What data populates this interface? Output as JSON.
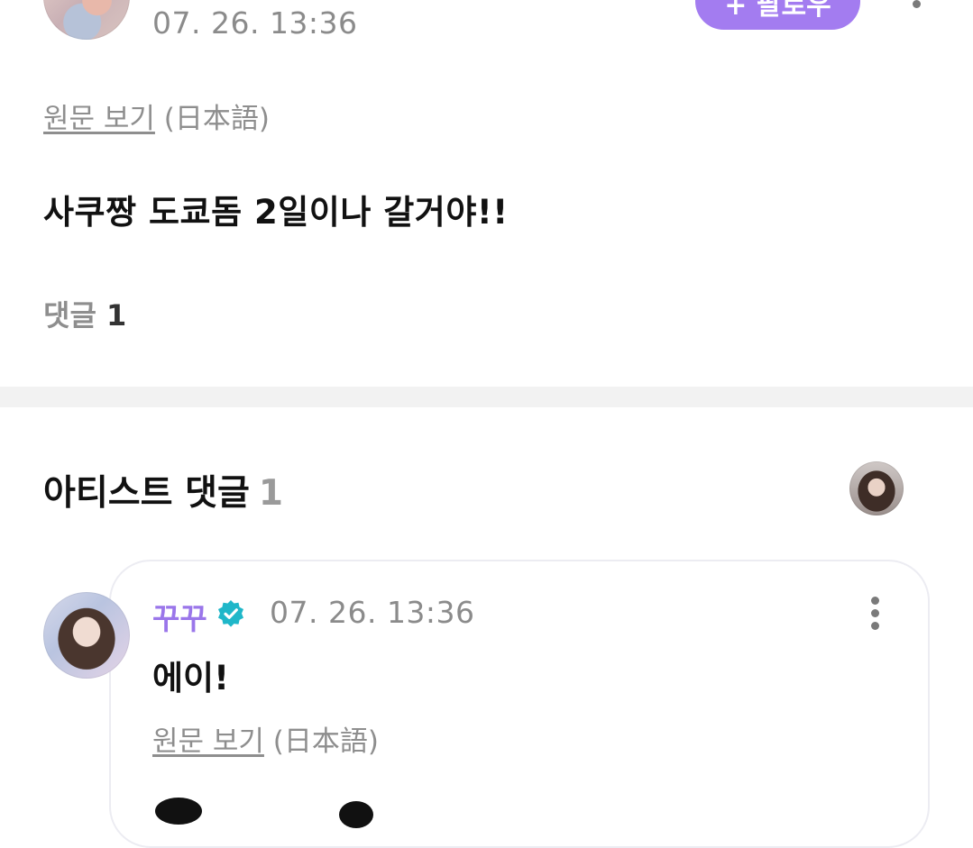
{
  "post": {
    "time": "07. 26. 13:36",
    "follow_label": "+ 팔로우",
    "original_link": "원문 보기",
    "original_lang": "(日本語)",
    "body": "사쿠짱 도쿄돔 2일이나 갈거야!!",
    "comment_label": "댓글",
    "comment_count": "1"
  },
  "artist_comments": {
    "title": "아티스트 댓글",
    "count": "1",
    "reply": {
      "name": "꾸꾸",
      "time": "07. 26. 13:36",
      "text": "에이!",
      "original_link": "원문 보기",
      "original_lang": "(日本語)"
    }
  },
  "colors": {
    "accent": "#a37cf0",
    "artist_name": "#9a76ea",
    "verified": "#1fb7c9",
    "muted": "#8b8b8b"
  }
}
